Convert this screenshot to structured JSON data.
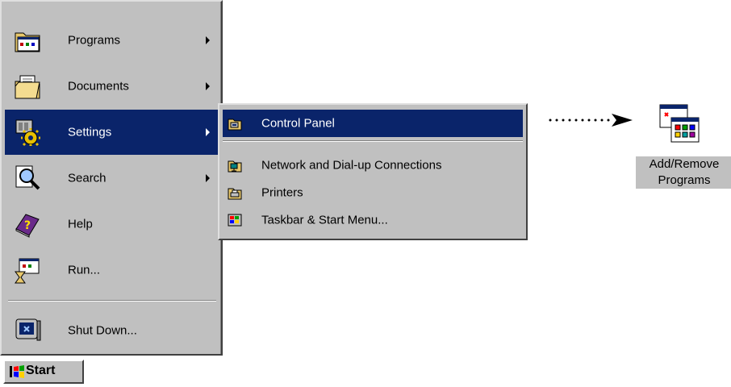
{
  "start_menu": {
    "items": [
      {
        "label": "Programs",
        "icon": "programs-icon",
        "submenu": true
      },
      {
        "label": "Documents",
        "icon": "documents-icon",
        "submenu": true
      },
      {
        "label": "Settings",
        "icon": "settings-icon",
        "submenu": true,
        "selected": true
      },
      {
        "label": "Search",
        "icon": "search-icon",
        "submenu": true
      },
      {
        "label": "Help",
        "icon": "help-icon",
        "submenu": false
      },
      {
        "label": "Run...",
        "icon": "run-icon",
        "submenu": false
      },
      {
        "label": "Shut Down...",
        "icon": "shut-down-icon",
        "submenu": false
      }
    ]
  },
  "settings_submenu": {
    "items": [
      {
        "label": "Control Panel",
        "icon": "control-panel-icon",
        "selected": true
      },
      {
        "label": "Network and Dial-up Connections",
        "icon": "network-icon"
      },
      {
        "label": "Printers",
        "icon": "printers-icon"
      },
      {
        "label": "Taskbar & Start Menu...",
        "icon": "taskbar-icon"
      }
    ]
  },
  "start_button": {
    "label": "Start"
  },
  "desktop_icon": {
    "label_line1": "Add/Remove",
    "label_line2": "Programs",
    "icon": "add-remove-programs-icon"
  },
  "colors": {
    "menu_bg": "#c0c0c0",
    "highlight": "#0a246a",
    "highlight_text": "#ffffff"
  }
}
